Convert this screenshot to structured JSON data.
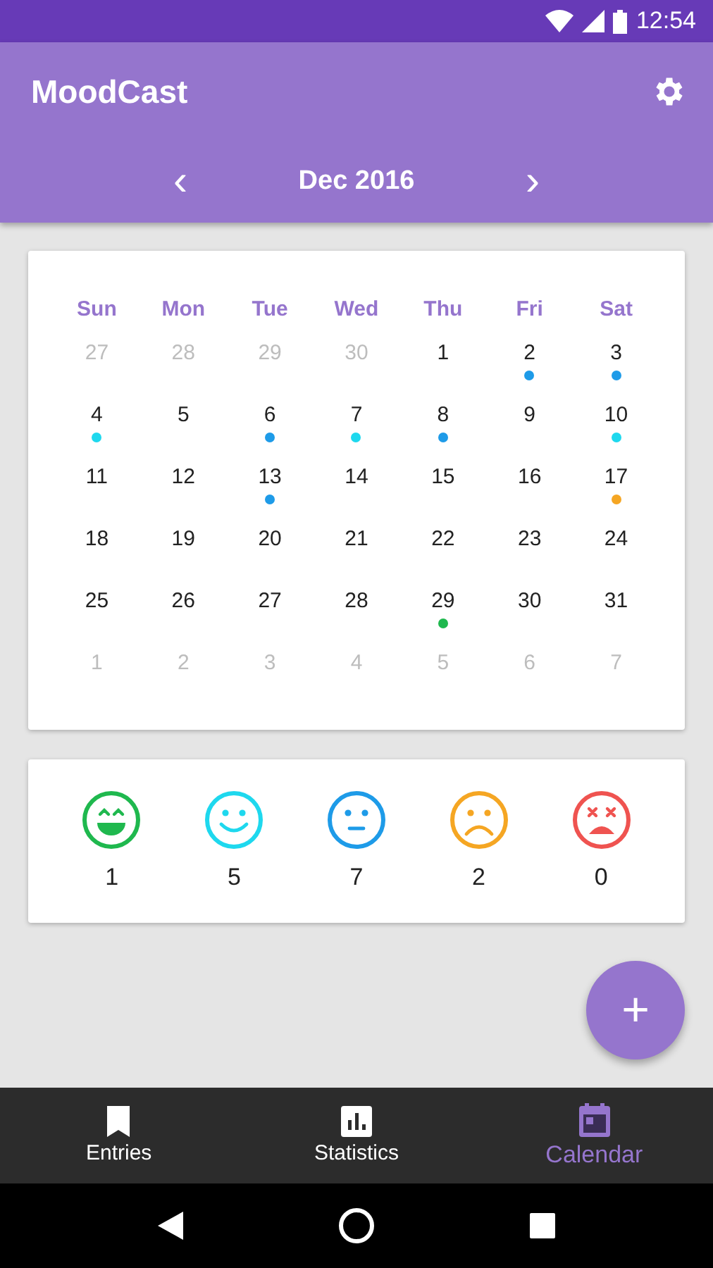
{
  "status_bar": {
    "time": "12:54"
  },
  "app_bar": {
    "title": "MoodCast",
    "month": "Dec 2016",
    "prev": "‹",
    "next": "›"
  },
  "calendar": {
    "weekdays": [
      "Sun",
      "Mon",
      "Tue",
      "Wed",
      "Thu",
      "Fri",
      "Sat"
    ],
    "weeks": [
      [
        {
          "day": "27",
          "muted": true
        },
        {
          "day": "28",
          "muted": true
        },
        {
          "day": "29",
          "muted": true
        },
        {
          "day": "30",
          "muted": true
        },
        {
          "day": "1",
          "muted": false
        },
        {
          "day": "2",
          "muted": false,
          "color": "#1e9be8"
        },
        {
          "day": "3",
          "muted": false,
          "color": "#1e9be8"
        }
      ],
      [
        {
          "day": "4",
          "muted": false,
          "color": "#1ed8ee"
        },
        {
          "day": "5",
          "muted": false
        },
        {
          "day": "6",
          "muted": false,
          "color": "#1e9be8"
        },
        {
          "day": "7",
          "muted": false,
          "color": "#1ed8ee"
        },
        {
          "day": "8",
          "muted": false,
          "color": "#1e9be8"
        },
        {
          "day": "9",
          "muted": false
        },
        {
          "day": "10",
          "muted": false,
          "color": "#1ed8ee"
        }
      ],
      [
        {
          "day": "11",
          "muted": false
        },
        {
          "day": "12",
          "muted": false
        },
        {
          "day": "13",
          "muted": false,
          "color": "#1e9be8"
        },
        {
          "day": "14",
          "muted": false
        },
        {
          "day": "15",
          "muted": false
        },
        {
          "day": "16",
          "muted": false
        },
        {
          "day": "17",
          "muted": false,
          "color": "#f5a623"
        }
      ],
      [
        {
          "day": "18",
          "muted": false
        },
        {
          "day": "19",
          "muted": false
        },
        {
          "day": "20",
          "muted": false
        },
        {
          "day": "21",
          "muted": false
        },
        {
          "day": "22",
          "muted": false
        },
        {
          "day": "23",
          "muted": false
        },
        {
          "day": "24",
          "muted": false
        }
      ],
      [
        {
          "day": "25",
          "muted": false
        },
        {
          "day": "26",
          "muted": false
        },
        {
          "day": "27",
          "muted": false
        },
        {
          "day": "28",
          "muted": false
        },
        {
          "day": "29",
          "muted": false,
          "color": "#1fb84e"
        },
        {
          "day": "30",
          "muted": false
        },
        {
          "day": "31",
          "muted": false
        }
      ],
      [
        {
          "day": "1",
          "muted": true
        },
        {
          "day": "2",
          "muted": true
        },
        {
          "day": "3",
          "muted": true
        },
        {
          "day": "4",
          "muted": true
        },
        {
          "day": "5",
          "muted": true
        },
        {
          "day": "6",
          "muted": true
        },
        {
          "day": "7",
          "muted": true
        }
      ]
    ]
  },
  "moods": [
    {
      "kind": "great",
      "color": "#1fb84e",
      "count": "1"
    },
    {
      "kind": "good",
      "color": "#1ed8ee",
      "count": "5"
    },
    {
      "kind": "okay",
      "color": "#1e9be8",
      "count": "7"
    },
    {
      "kind": "bad",
      "color": "#f5a623",
      "count": "2"
    },
    {
      "kind": "awful",
      "color": "#ef5350",
      "count": "0"
    }
  ],
  "fab": {
    "label": "+"
  },
  "bottom_nav": [
    {
      "kind": "bookmark",
      "label": "Entries",
      "selected": false
    },
    {
      "kind": "chart",
      "label": "Statistics",
      "selected": false
    },
    {
      "kind": "calendar",
      "label": "Calendar",
      "selected": true
    }
  ]
}
